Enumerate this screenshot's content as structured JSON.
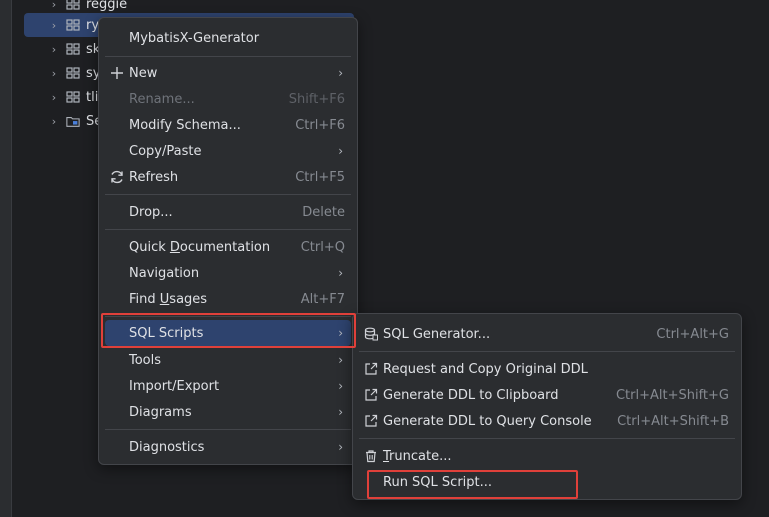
{
  "tree": [
    {
      "label": "reggie"
    },
    {
      "label": "ry"
    },
    {
      "label": "sk"
    },
    {
      "label": "sy"
    },
    {
      "label": "tli"
    },
    {
      "label": "Se"
    }
  ],
  "context_menu": {
    "items": {
      "mybatisx": {
        "label": "MybatisX-Generator"
      },
      "new": {
        "label": "New"
      },
      "rename": {
        "label": "Rename...",
        "shortcut": "Shift+F6"
      },
      "modify_schema": {
        "label": "Modify Schema...",
        "shortcut": "Ctrl+F6"
      },
      "copy_paste": {
        "label": "Copy/Paste"
      },
      "refresh": {
        "label": "Refresh",
        "shortcut": "Ctrl+F5"
      },
      "drop": {
        "label": "Drop...",
        "shortcut": "Delete"
      },
      "quick_doc": {
        "pre": "Quick ",
        "u": "D",
        "post": "ocumentation",
        "shortcut": "Ctrl+Q"
      },
      "navigation": {
        "label": "Navigation"
      },
      "find_usages": {
        "pre": "Find ",
        "u": "U",
        "post": "sages",
        "shortcut": "Alt+F7"
      },
      "sql_scripts": {
        "label": "SQL Scripts"
      },
      "tools": {
        "label": "Tools"
      },
      "import_export": {
        "label": "Import/Export"
      },
      "diagrams": {
        "label": "Diagrams"
      },
      "diagnostics": {
        "label": "Diagnostics"
      }
    }
  },
  "submenu": {
    "items": {
      "sql_generator": {
        "label": "SQL Generator...",
        "shortcut": "Ctrl+Alt+G"
      },
      "request_copy_ddl": {
        "label": "Request and Copy Original DDL"
      },
      "ddl_clipboard": {
        "label": "Generate DDL to Clipboard",
        "shortcut": "Ctrl+Alt+Shift+G"
      },
      "ddl_console": {
        "label": "Generate DDL to Query Console",
        "shortcut": "Ctrl+Alt+Shift+B"
      },
      "truncate": {
        "u": "T",
        "post": "runcate..."
      },
      "run_sql_script": {
        "label": "Run SQL Script..."
      }
    }
  },
  "annotation_color": "#e0403a",
  "highlight_color": "#2e436e"
}
